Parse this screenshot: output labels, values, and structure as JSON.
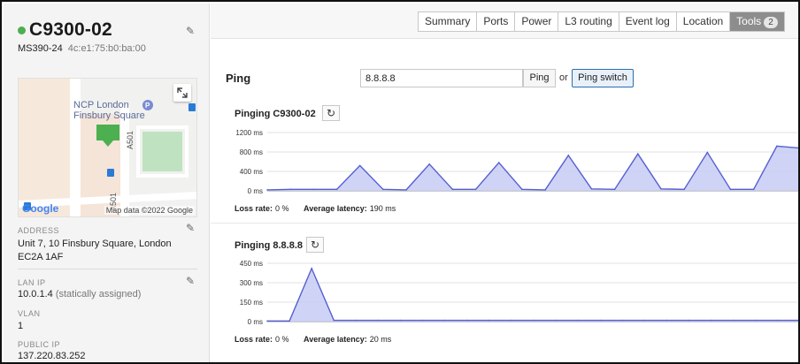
{
  "device": {
    "name": "C9300-02",
    "model": "MS390-24",
    "mac": "4c:e1:75:b0:ba:00",
    "status_color": "#4caf50"
  },
  "map": {
    "poi_label": "NCP London Finsbury Square",
    "road_label_1": "A501",
    "road_label_2": "A501",
    "logo": "Google",
    "copyright": "Map data ©2022 Google"
  },
  "fields": {
    "address_label": "ADDRESS",
    "address_value": "Unit 7, 10 Finsbury Square, London EC2A 1AF",
    "lan_ip_label": "LAN IP",
    "lan_ip_value": "10.0.1.4",
    "lan_ip_note": "(statically assigned)",
    "vlan_label": "VLAN",
    "vlan_value": "1",
    "public_ip_label": "PUBLIC IP",
    "public_ip_value": "137.220.83.252"
  },
  "tabs": [
    {
      "label": "Summary"
    },
    {
      "label": "Ports"
    },
    {
      "label": "Power"
    },
    {
      "label": "L3 routing"
    },
    {
      "label": "Event log"
    },
    {
      "label": "Location"
    },
    {
      "label": "Tools",
      "badge": "2",
      "active": true
    }
  ],
  "ping": {
    "title": "Ping",
    "input_value": "8.8.8.8",
    "ping_button": "Ping",
    "or_text": "or",
    "ping_switch_button": "Ping switch"
  },
  "sections": [
    {
      "title": "Pinging C9300-02",
      "loss_label": "Loss rate:",
      "loss_value": "0 %",
      "latency_label": "Average latency:",
      "latency_value": "190 ms"
    },
    {
      "title": "Pinging 8.8.8.8",
      "loss_label": "Loss rate:",
      "loss_value": "0 %",
      "latency_label": "Average latency:",
      "latency_value": "20 ms"
    }
  ],
  "chart_data": [
    {
      "type": "area",
      "title": "Pinging C9300-02",
      "ylim": [
        0,
        1200
      ],
      "y_ticks": [
        0,
        400,
        800,
        1200
      ],
      "y_tick_labels": [
        "0 ms",
        "400 ms",
        "800 ms",
        "1200 ms"
      ],
      "grid": true,
      "color": "#5560d0",
      "fill": "#c7cbf3",
      "values": [
        20,
        30,
        30,
        30,
        520,
        30,
        20,
        550,
        30,
        30,
        580,
        30,
        20,
        730,
        40,
        30,
        760,
        40,
        30,
        790,
        30,
        30,
        920,
        880
      ]
    },
    {
      "type": "area",
      "title": "Pinging 8.8.8.8",
      "ylim": [
        0,
        450
      ],
      "y_ticks": [
        0,
        150,
        300,
        450
      ],
      "y_tick_labels": [
        "0 ms",
        "150 ms",
        "300 ms",
        "450 ms"
      ],
      "grid": true,
      "color": "#5560d0",
      "fill": "#c7cbf3",
      "values": [
        5,
        5,
        410,
        10,
        10,
        10,
        10,
        10,
        10,
        10,
        10,
        10,
        10,
        10,
        10,
        10,
        10,
        10,
        10,
        10,
        10,
        10,
        10,
        10,
        10
      ]
    }
  ]
}
